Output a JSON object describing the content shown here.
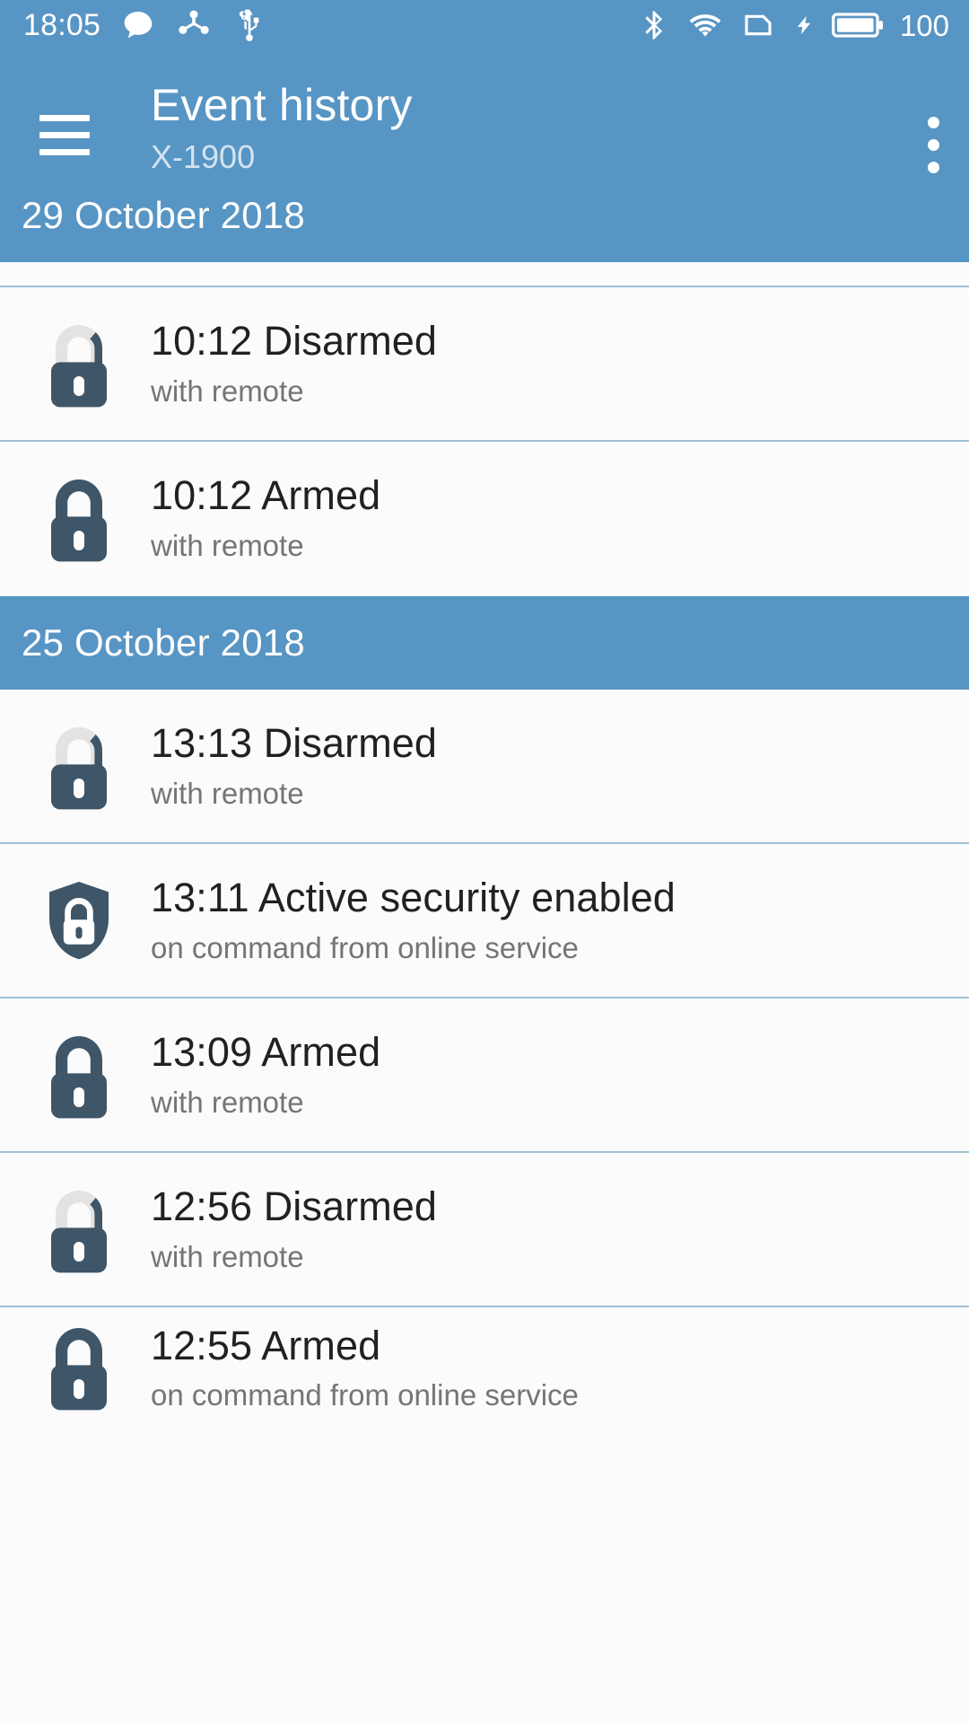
{
  "status_bar": {
    "time": "18:05",
    "battery_percent": "100",
    "left_icons": [
      "message-bubble-icon",
      "share-network-icon",
      "usb-icon"
    ],
    "right_icons": [
      "bluetooth-icon",
      "wifi-icon",
      "sim-card-icon",
      "charging-bolt-icon",
      "battery-full-icon"
    ]
  },
  "toolbar": {
    "menu_icon": "hamburger-menu-icon",
    "title": "Event history",
    "subtitle": "X-1900",
    "overflow_icon": "more-vertical-icon"
  },
  "theme": {
    "primary_blue": "#5795c4",
    "divider": "#9fc0d5",
    "lock_dark": "#3f5668",
    "lock_light": "#e3e3e3",
    "title_text": "#212121",
    "sub_text": "#757575",
    "page_bg": "#fbfbfb"
  },
  "sections": [
    {
      "date": "29 October 2018",
      "events": [
        {
          "icon": "padlock-open-icon",
          "time": "10:12",
          "event": "Disarmed",
          "title": "10:12 Disarmed",
          "source": "with remote"
        },
        {
          "icon": "padlock-closed-icon",
          "time": "10:12",
          "event": "Armed",
          "title": "10:12 Armed",
          "source": "with remote"
        }
      ]
    },
    {
      "date": "25 October 2018",
      "events": [
        {
          "icon": "padlock-open-icon",
          "time": "13:13",
          "event": "Disarmed",
          "title": "13:13 Disarmed",
          "source": "with remote"
        },
        {
          "icon": "shield-lock-icon",
          "time": "13:11",
          "event": "Active security enabled",
          "title": "13:11 Active security enabled",
          "source": "on command from online service"
        },
        {
          "icon": "padlock-closed-icon",
          "time": "13:09",
          "event": "Armed",
          "title": "13:09 Armed",
          "source": "with remote"
        },
        {
          "icon": "padlock-open-icon",
          "time": "12:56",
          "event": "Disarmed",
          "title": "12:56 Disarmed",
          "source": "with remote"
        },
        {
          "icon": "padlock-closed-icon",
          "time": "12:55",
          "event": "Armed",
          "title": "12:55 Armed",
          "source": "on command from online service"
        }
      ]
    }
  ]
}
